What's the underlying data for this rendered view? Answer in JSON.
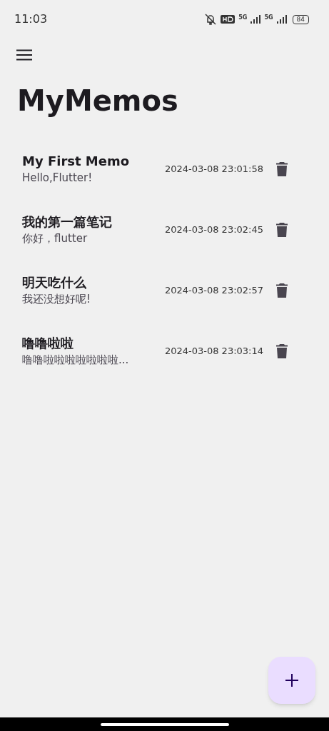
{
  "status_bar": {
    "time": "11:03",
    "network_1": "5G",
    "network_2": "5G",
    "battery": "84"
  },
  "app_bar": {
    "title": "MyMemos"
  },
  "memos": [
    {
      "title": "My First Memo",
      "body": "Hello,Flutter!",
      "timestamp": "2024-03-08 23:01:58"
    },
    {
      "title": "我的第一篇笔记",
      "body": "你好，flutter",
      "timestamp": "2024-03-08 23:02:45"
    },
    {
      "title": "明天吃什么",
      "body": "我还没想好呢!",
      "timestamp": "2024-03-08 23:02:57"
    },
    {
      "title": "噜噜啦啦",
      "body": "噜噜啦啦啦啦啦啦啦...",
      "timestamp": "2024-03-08 23:03:14"
    }
  ]
}
